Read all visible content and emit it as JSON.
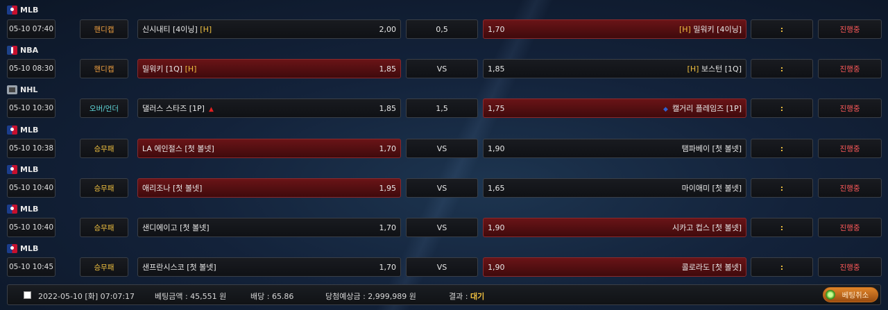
{
  "games": [
    {
      "league": "MLB",
      "icon": "mlb-icon",
      "time": "05-10 07:40",
      "type": "핸디캡",
      "home": "신시내티 [4이닝] ",
      "home_mark": "[H]",
      "home_odds": "2,00",
      "mid": "0,5",
      "away_odds": "1,70",
      "away_mark": "[H] ",
      "away": "밀워키 [4이닝]",
      "status": "진행중"
    },
    {
      "league": "NBA",
      "icon": "nba-icon",
      "time": "05-10 08:30",
      "type": "핸디캡",
      "home": "밀워키 [1Q] ",
      "home_mark": "[H]",
      "home_odds": "1,85",
      "mid": "VS",
      "away_odds": "1,85",
      "away_mark": "[H] ",
      "away": "보스턴 [1Q]",
      "status": "진행중"
    },
    {
      "league": "NHL",
      "icon": "nhl-icon",
      "time": "05-10 10:30",
      "type": "오버/언더",
      "home": "댈러스 스타즈 [1P]",
      "home_mark": "",
      "home_odds": "1,85",
      "mid": "1,5",
      "away_odds": "1,75",
      "away_mark": "",
      "away": "캘거리 플레임즈 [1P]",
      "status": "진행중"
    },
    {
      "league": "MLB",
      "icon": "mlb-icon",
      "time": "05-10 10:38",
      "type": "승무패",
      "home": "LA 에인절스 [첫 볼넷]",
      "home_mark": "",
      "home_odds": "1,70",
      "mid": "VS",
      "away_odds": "1,90",
      "away_mark": "",
      "away": "탬파베이 [첫 볼넷]",
      "status": "진행중"
    },
    {
      "league": "MLB",
      "icon": "mlb-icon",
      "time": "05-10 10:40",
      "type": "승무패",
      "home": "애리조나 [첫 볼넷]",
      "home_mark": "",
      "home_odds": "1,95",
      "mid": "VS",
      "away_odds": "1,65",
      "away_mark": "",
      "away": "마이애미 [첫 볼넷]",
      "status": "진행중"
    },
    {
      "league": "MLB",
      "icon": "mlb-icon",
      "time": "05-10 10:40",
      "type": "승무패",
      "home": "샌디에이고 [첫 볼넷]",
      "home_mark": "",
      "home_odds": "1,70",
      "mid": "VS",
      "away_odds": "1,90",
      "away_mark": "",
      "away": "시카고 컵스 [첫 볼넷]",
      "status": "진행중"
    },
    {
      "league": "MLB",
      "icon": "mlb-icon",
      "time": "05-10 10:45",
      "type": "승무패",
      "home": "샌프란시스코 [첫 볼넷]",
      "home_mark": "",
      "home_odds": "1,70",
      "mid": "VS",
      "away_odds": "1,90",
      "away_mark": "",
      "away": "콜로라도 [첫 볼넷]",
      "status": "진행중"
    }
  ],
  "colon": ":",
  "footer": {
    "datetime": "2022-05-10 [화] 07:07:17",
    "bet_amount": "베팅금액 : 45,551 원",
    "odds": "배당 : 65.86",
    "expected": "당첨예상금 : 2,999,989 원",
    "result_label": "결과 : ",
    "result_value": "대기",
    "cancel_label": "베팅취소"
  }
}
